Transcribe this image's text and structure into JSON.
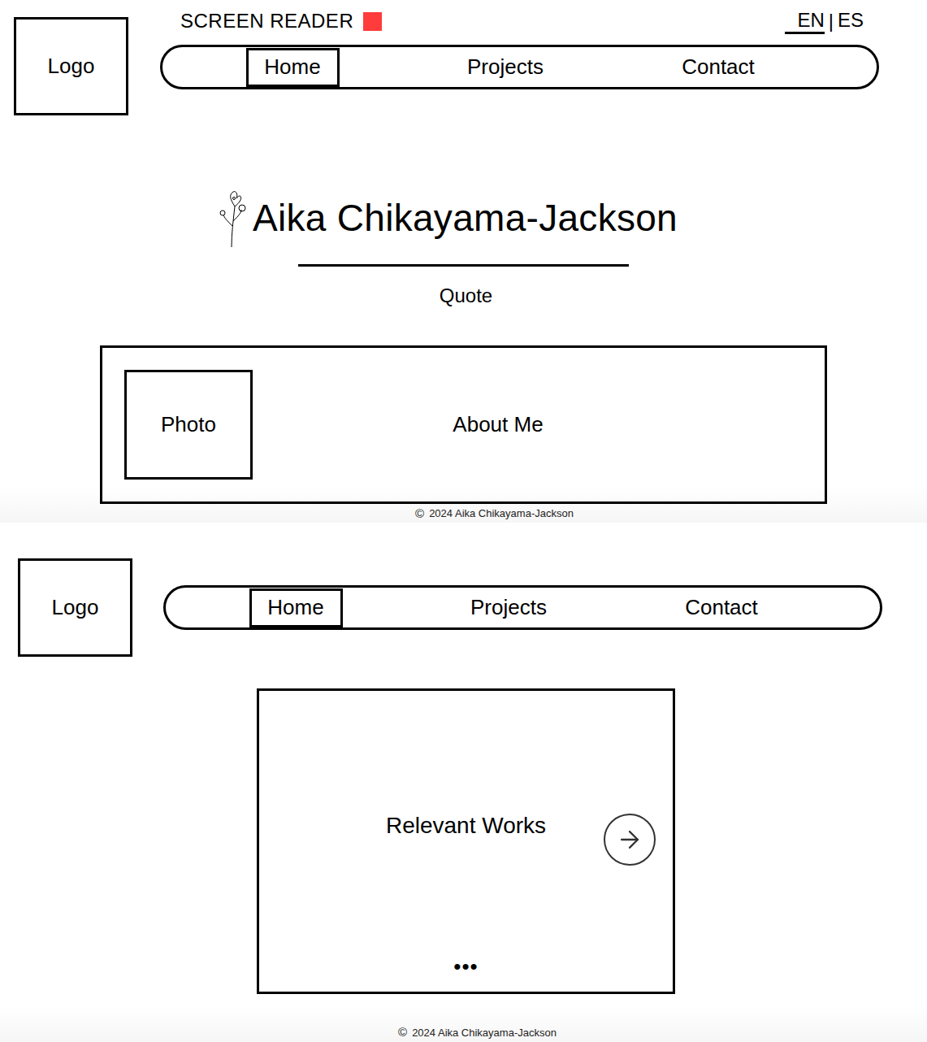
{
  "accessibility": {
    "label": "SCREEN READER",
    "on": true,
    "color": "#ff3b3b"
  },
  "languages": {
    "items": [
      {
        "label": "EN",
        "selected": true
      },
      {
        "label": "ES",
        "selected": false
      }
    ],
    "separator": "|"
  },
  "pages": [
    {
      "logo": "Logo",
      "nav": [
        {
          "label": "Home",
          "selected": true
        },
        {
          "label": "Projects",
          "selected": false
        },
        {
          "label": "Contact",
          "selected": false
        }
      ],
      "hero": {
        "title": "Aika Chikayama-Jackson",
        "quote": "Quote"
      },
      "about": {
        "photo": "Photo",
        "text": "About Me"
      },
      "footer": {
        "symbol": "©",
        "text": "2024 Aika Chikayama-Jackson"
      }
    },
    {
      "logo": "Logo",
      "nav": [
        {
          "label": "Home",
          "selected": true
        },
        {
          "label": "Projects",
          "selected": false
        },
        {
          "label": "Contact",
          "selected": false
        }
      ],
      "works": {
        "title": "Relevant Works",
        "dots": "•••"
      },
      "footer": {
        "symbol": "©",
        "text": "2024 Aika Chikayama-Jackson"
      }
    }
  ]
}
